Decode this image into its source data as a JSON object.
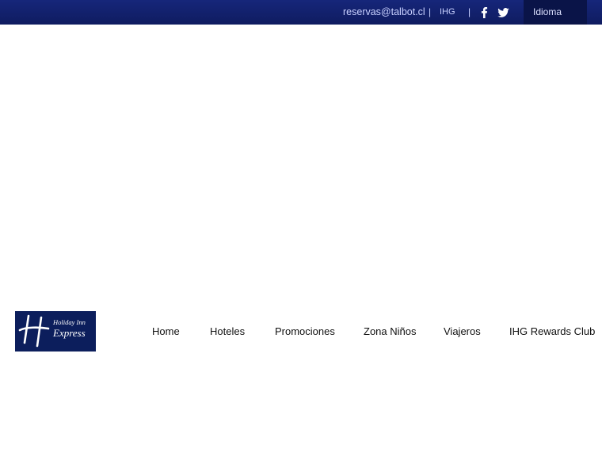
{
  "topbar": {
    "email": "reservas@talbot.cl",
    "separator": "|",
    "ihg_label": "IHG",
    "facebook_icon": "facebook-icon",
    "twitter_icon": "twitter-icon",
    "language_label": "Idioma"
  },
  "logo": {
    "line1": "Holiday Inn",
    "line2": "Express"
  },
  "nav": {
    "items": [
      {
        "label": "Home"
      },
      {
        "label": "Hoteles"
      },
      {
        "label": "Promociones"
      },
      {
        "label": "Zona Niños"
      },
      {
        "label": "Viajeros"
      },
      {
        "label": "IHG Rewards Club"
      }
    ]
  },
  "colors": {
    "topbar_bg": "#12216d",
    "language_bg": "#0a1448",
    "logo_bg": "#0c1e5c",
    "nav_text": "#111111"
  }
}
